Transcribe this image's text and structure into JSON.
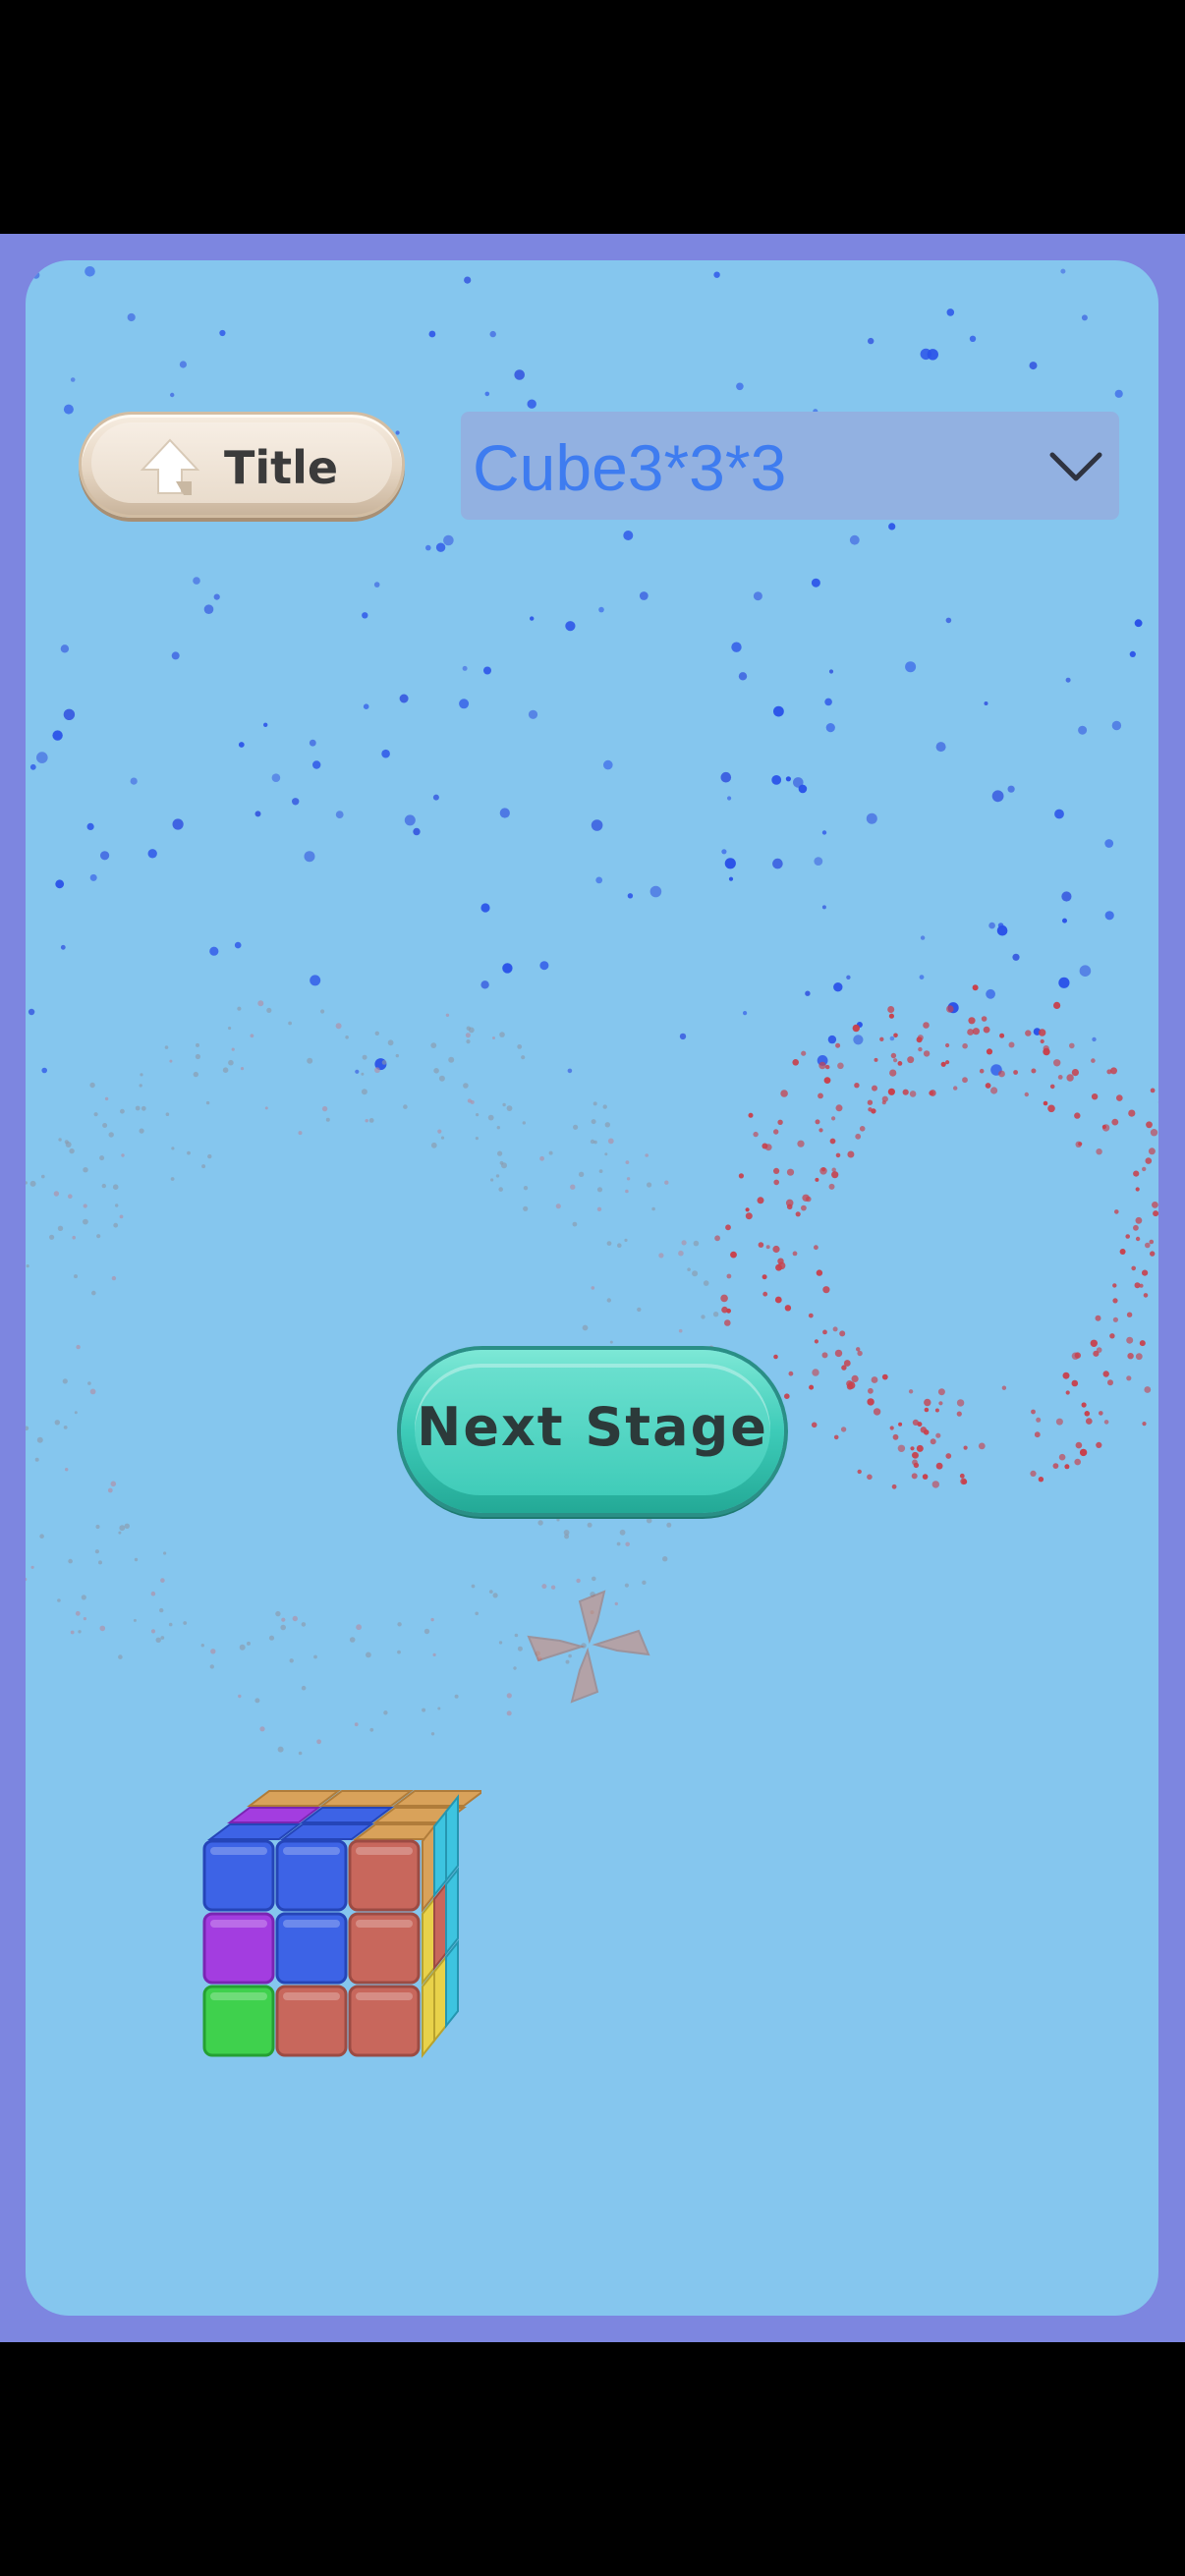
{
  "header": {
    "title_button_label": "Title",
    "stage_select": {
      "value": "Cube3*3*3"
    }
  },
  "main": {
    "next_stage_label": "Next Stage"
  },
  "icons": {
    "title_icon": "up-arrow-icon",
    "select_icon": "chevron-down-icon",
    "effect_icon": "pinwheel-icon"
  },
  "colors": {
    "background": "#85c6ee",
    "frame": "#7d86e0",
    "select_text": "#3e7cf0",
    "next_button": "#3dcbb8",
    "title_button": "#e6d6c3"
  },
  "cube": {
    "front_face": [
      [
        "blue",
        "blue",
        "red"
      ],
      [
        "purple",
        "blue",
        "red"
      ],
      [
        "green",
        "red",
        "red"
      ]
    ],
    "top_face": [
      [
        "orange",
        "orange",
        "orange"
      ],
      [
        "purple",
        "blue",
        "orange"
      ],
      [
        "blue",
        "blue",
        "orange"
      ]
    ],
    "right_face": [
      [
        "orange",
        "cyan",
        "cyan"
      ],
      [
        "yellow",
        "red",
        "cyan"
      ],
      [
        "yellow",
        "yellow",
        "cyan"
      ]
    ]
  }
}
